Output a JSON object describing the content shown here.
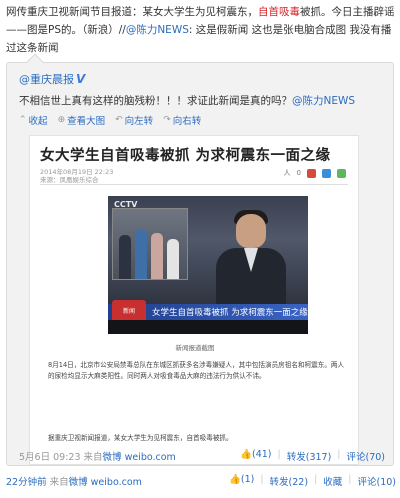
{
  "post": {
    "text_part1": "网传重庆卫视新闻节目报道：某女大学生为见柯震东，",
    "text_highlight": "自首吸毒",
    "text_part2": "被抓。今日主播辟谣——图是PS的。（新浪）//",
    "mention": "@陈力NEWS",
    "text_part3": ": 这是假新闻 这也是张电脑合成图 我没有播过这条新闻",
    "time": "22分钟前",
    "source_prefix": "来自",
    "source": "微博 weibo.com",
    "actions": {
      "like": "(1)",
      "repost": "转发(22)",
      "favorite": "收藏",
      "comment": "评论(10)"
    }
  },
  "repost": {
    "author": "@重庆晨报",
    "verified": "V",
    "text_part1": "不相信世上真有这样的脑残粉！！！求证此新闻是真的吗？",
    "mention": "@陈力NEWS",
    "toolbar": {
      "collapse": "收起",
      "view_large": "查看大图",
      "rotate_left": "向左转",
      "rotate_right": "向右转"
    },
    "time": "5月6日 09:23",
    "source_prefix": "来自",
    "source": "微博 weibo.com",
    "actions": {
      "like": "(41)",
      "repost": "转发(317)",
      "comment": "评论(70)"
    }
  },
  "article": {
    "headline": "女大学生自首吸毒被抓 为求柯震东一面之缘",
    "meta": "2014年08月19日 22:23",
    "source": "来源：凤凰娱乐综合",
    "social": [
      "人",
      "0"
    ],
    "tv_logo": "CCTV",
    "tv_caption": "女学生自首吸毒被抓 为求柯震东一面之缘",
    "tv_badge": "新闻",
    "image_caption": "新闻报道截图",
    "body": "8月14日，北京市公安局禁毒总队在东城区抓获多名涉毒嫌疑人，其中包括演员房祖名和柯震东。两人的尿检均显示大麻类阳性。同时两人对吸食毒品大麻的违法行为供认不讳。",
    "footer": "据重庆卫视新闻报道，某女大学生为见柯震东，自首吸毒被抓。"
  },
  "colors": {
    "link": "#2a6cc0",
    "highlight": "#d6242a",
    "muted": "#999999"
  }
}
